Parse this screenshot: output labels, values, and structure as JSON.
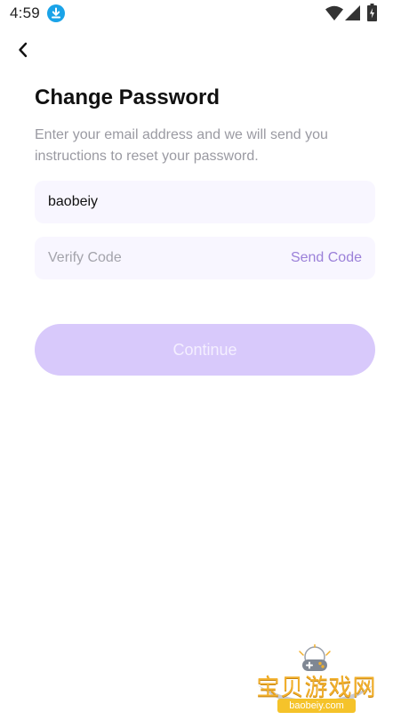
{
  "status_bar": {
    "time": "4:59"
  },
  "icons": {
    "download": "download-icon",
    "wifi": "wifi-icon",
    "signal": "signal-icon",
    "battery": "battery-icon",
    "back": "chevron-left-icon"
  },
  "page": {
    "title": "Change Password",
    "subtitle": "Enter your email address and we will send you instructions to reset your password."
  },
  "form": {
    "email_value": "baobeiy",
    "code_placeholder": "Verify Code",
    "send_code_label": "Send Code",
    "continue_label": "Continue"
  },
  "watermark": {
    "brand_cn": "宝贝游戏网",
    "url": "baobeiy.com"
  },
  "colors": {
    "accent": "#9b80d9",
    "button_disabled_bg": "#d8c9fb",
    "field_bg": "#f8f6ff",
    "subtitle": "#9a9aa2",
    "download_badge": "#1aa3e8"
  }
}
